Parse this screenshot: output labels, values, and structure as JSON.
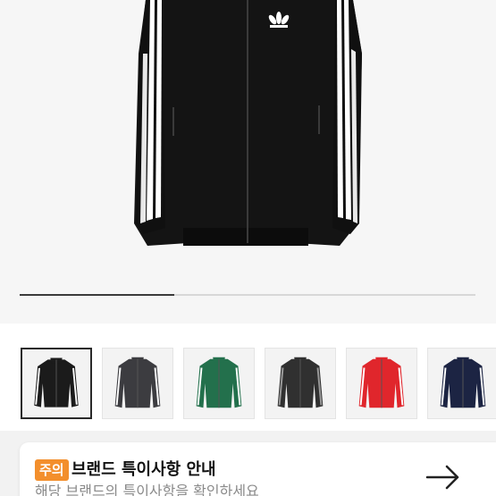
{
  "product": {
    "image_description_icon": "track-jacket-icon",
    "brand_logo_icon": "trefoil-logo-icon"
  },
  "gallery": {
    "progress_fraction": 0.34
  },
  "thumbnails": [
    {
      "color_name": "black",
      "body": "#1b1b1b",
      "stripe": "#ffffff",
      "selected": true
    },
    {
      "color_name": "dark-grey",
      "body": "#3c3c40",
      "stripe": "#ffffff",
      "selected": false
    },
    {
      "color_name": "green",
      "body": "#23704c",
      "stripe": "#ffffff",
      "selected": false
    },
    {
      "color_name": "charcoal",
      "body": "#303030",
      "stripe": "#9a9a9a",
      "selected": false
    },
    {
      "color_name": "red",
      "body": "#e0262c",
      "stripe": "#ffffff",
      "selected": false
    },
    {
      "color_name": "navy",
      "body": "#1c2443",
      "stripe": "#ffffff",
      "selected": false
    }
  ],
  "notice": {
    "badge": "주의",
    "title": "브랜드 특이사항 안내",
    "subtitle": "해당 브랜드의 특이사항을 확인하세요",
    "arrow_icon": "arrow-right-icon"
  },
  "colors": {
    "accent_badge": "#f38f2c",
    "progress_active": "#3b3b3b",
    "progress_track": "#d7d7d7"
  }
}
